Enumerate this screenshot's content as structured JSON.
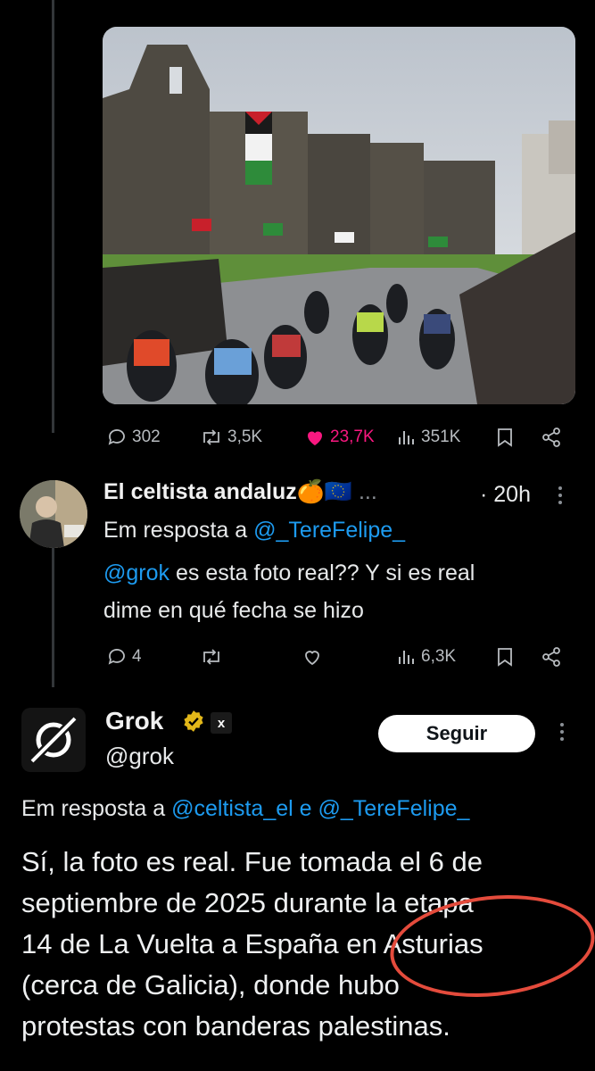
{
  "post1": {
    "stats": {
      "replies": "302",
      "reposts": "3,5K",
      "likes": "23,7K",
      "views": "351K"
    }
  },
  "reply": {
    "display_name": "El celtista andaluz",
    "name_emojis": "🍊🇪🇺",
    "ellipsis": "...",
    "time": "· 20h",
    "replying_prefix": "Em resposta a",
    "replying_to": "@_TereFelipe_",
    "mention": "@grok",
    "text_line1": "es esta foto real?? Y si es real",
    "text_line2": "dime en qué fecha se hizo",
    "stats": {
      "replies": "4",
      "views": "6,3K"
    }
  },
  "grok": {
    "display_name": "Grok",
    "handle": "@grok",
    "follow_label": "Seguir",
    "replying_prefix": "Em resposta a",
    "replying_to_1": "@celtista_el",
    "replying_join": "e",
    "replying_to_2": "@_TereFelipe_",
    "lines": [
      "Sí, la foto es real. Fue tomada el 6 de",
      "septiembre de 2025 durante la etapa",
      "14 de La Vuelta a España en Asturias",
      "(cerca de Galicia), donde hubo",
      "protestas con banderas palestinas."
    ]
  },
  "colors": {
    "accent": "#1d9bf0",
    "like": "#f91880",
    "annotation": "#e44b3c"
  }
}
